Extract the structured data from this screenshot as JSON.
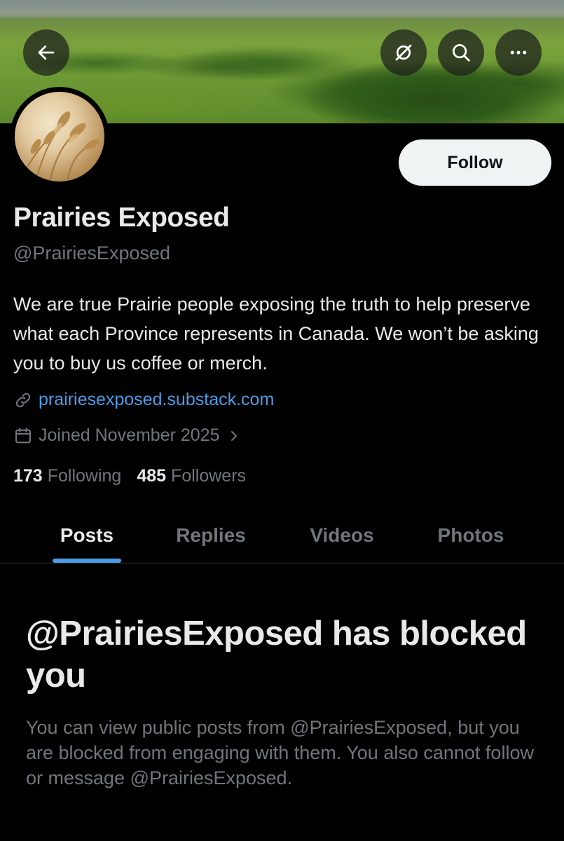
{
  "profile": {
    "name": "Prairies Exposed",
    "handle": "@PrairiesExposed",
    "bio": "We are true Prairie people exposing the truth to help preserve what each Province represents in Canada. We won’t be asking you to buy us coffee or merch.",
    "link": "prairiesexposed.substack.com",
    "joined": "Joined November 2025",
    "following_count": "173",
    "following_label": "Following",
    "followers_count": "485",
    "followers_label": "Followers"
  },
  "actions": {
    "follow_label": "Follow"
  },
  "icons": {
    "back": "arrow-left-icon",
    "grok": "slashed-circle-icon",
    "search": "search-icon",
    "more": "more-dots-icon",
    "link": "link-icon",
    "calendar": "calendar-icon",
    "chevron": "chevron-right-icon"
  },
  "tabs": [
    {
      "label": "Posts",
      "active": true
    },
    {
      "label": "Replies",
      "active": false
    },
    {
      "label": "Videos",
      "active": false
    },
    {
      "label": "Photos",
      "active": false
    }
  ],
  "blocked": {
    "title": "@PrairiesExposed has blocked you",
    "body": "You can view public posts from @PrairiesExposed, but you are blocked from engaging with them. You also cannot follow or message @PrairiesExposed."
  },
  "colors": {
    "background": "#000000",
    "accent": "#4a9de6",
    "text_primary": "#e7e9ea",
    "text_secondary": "#71767b"
  }
}
